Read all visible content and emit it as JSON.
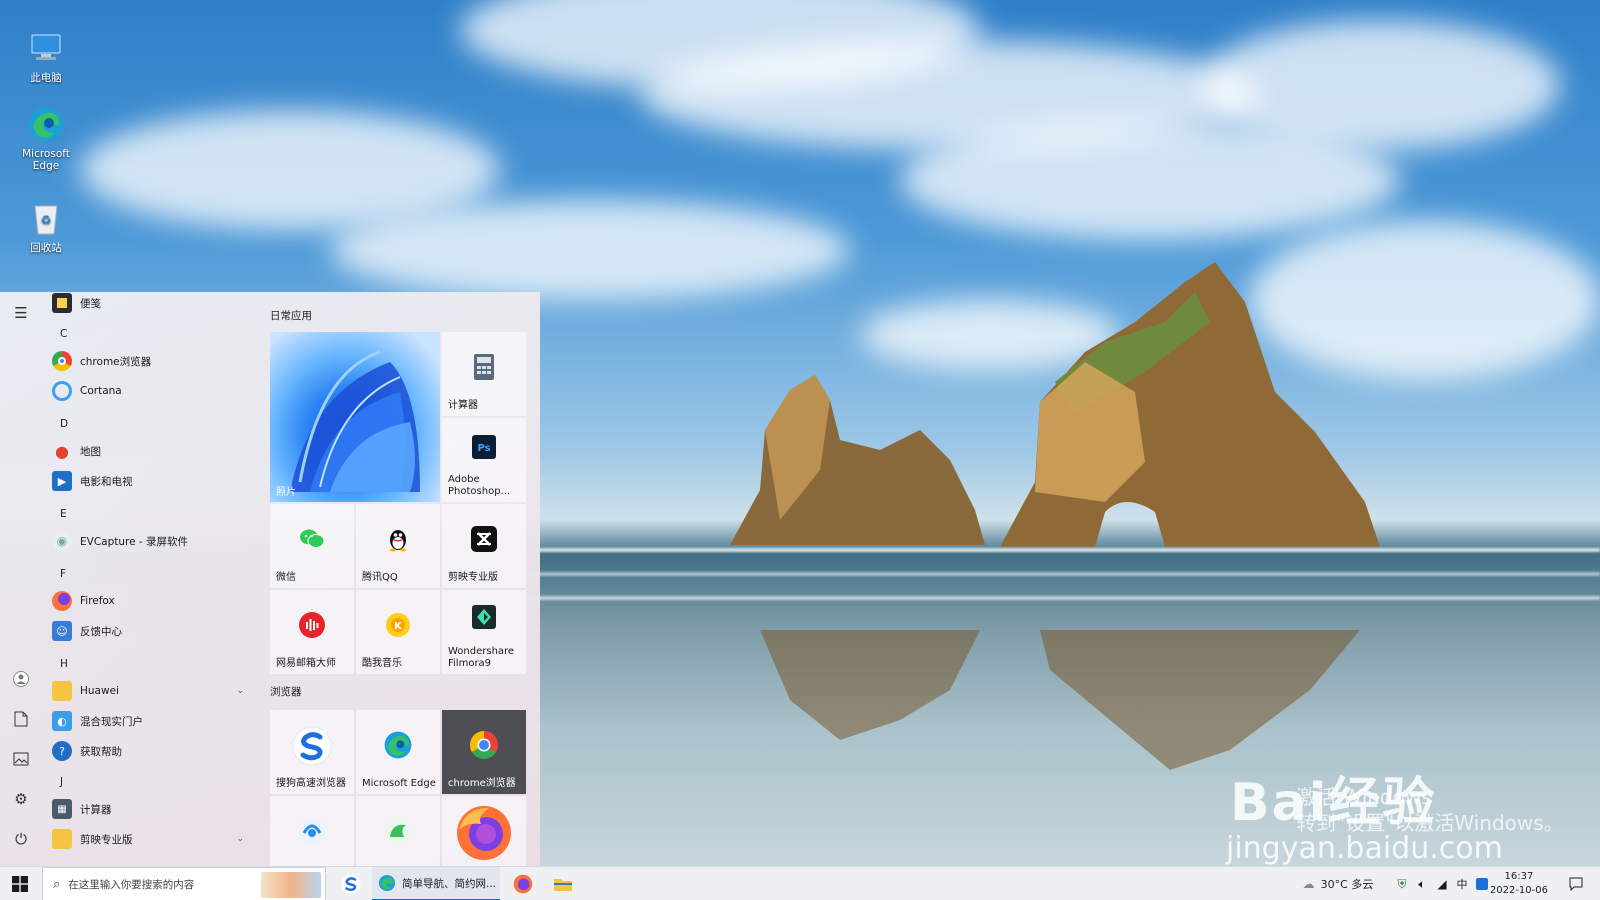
{
  "desktop": {
    "icons": [
      {
        "label": "此电脑",
        "icon": "computer-icon"
      },
      {
        "label": "Microsoft Edge",
        "icon": "edge-icon"
      },
      {
        "label": "回收站",
        "icon": "recycle-bin-icon"
      }
    ]
  },
  "start_menu": {
    "app_list": {
      "letters": {
        "c": "C",
        "d": "D",
        "e": "E",
        "f": "F",
        "h": "H",
        "j": "J"
      },
      "items": {
        "bianqian": "便笺",
        "chrome": "chrome浏览器",
        "cortana": "Cortana",
        "maps": "地图",
        "movies": "电影和电视",
        "evcapture": "EVCapture - 录屏软件",
        "firefox": "Firefox",
        "feedback": "反馈中心",
        "huawei": "Huawei",
        "mixed_reality": "混合现实门户",
        "get_help": "获取帮助",
        "calculator": "计算器",
        "jianying": "剪映专业版"
      }
    },
    "tiles": {
      "group_daily": "日常应用",
      "group_browsers": "浏览器",
      "photos": "照片",
      "calculator": "计算器",
      "photoshop": "Adobe Photoshop...",
      "wechat": "微信",
      "qq": "腾讯QQ",
      "jianying": "剪映专业版",
      "netease_mail": "网易邮箱大师",
      "kuwo": "酷我音乐",
      "filmora": "Wondershare Filmora9",
      "sogou": "搜狗高速浏览器",
      "edge": "Microsoft Edge",
      "chrome": "chrome浏览器"
    }
  },
  "taskbar": {
    "search_placeholder": "在这里输入你要搜索的内容",
    "active_window": "简单导航、简约网...",
    "weather": "30°C 多云",
    "time": "16:37",
    "date": "2022-10-06"
  },
  "watermark": {
    "logo": "Bai经验",
    "url": "jingyan.baidu.com",
    "activate_line1": "激活 Windows",
    "activate_line2": "转到\"设置\"以激活Windows。"
  },
  "colors": {
    "accent": "#0078d4",
    "taskbar": "#eef0f4",
    "start_menu": "#ece8ee"
  }
}
